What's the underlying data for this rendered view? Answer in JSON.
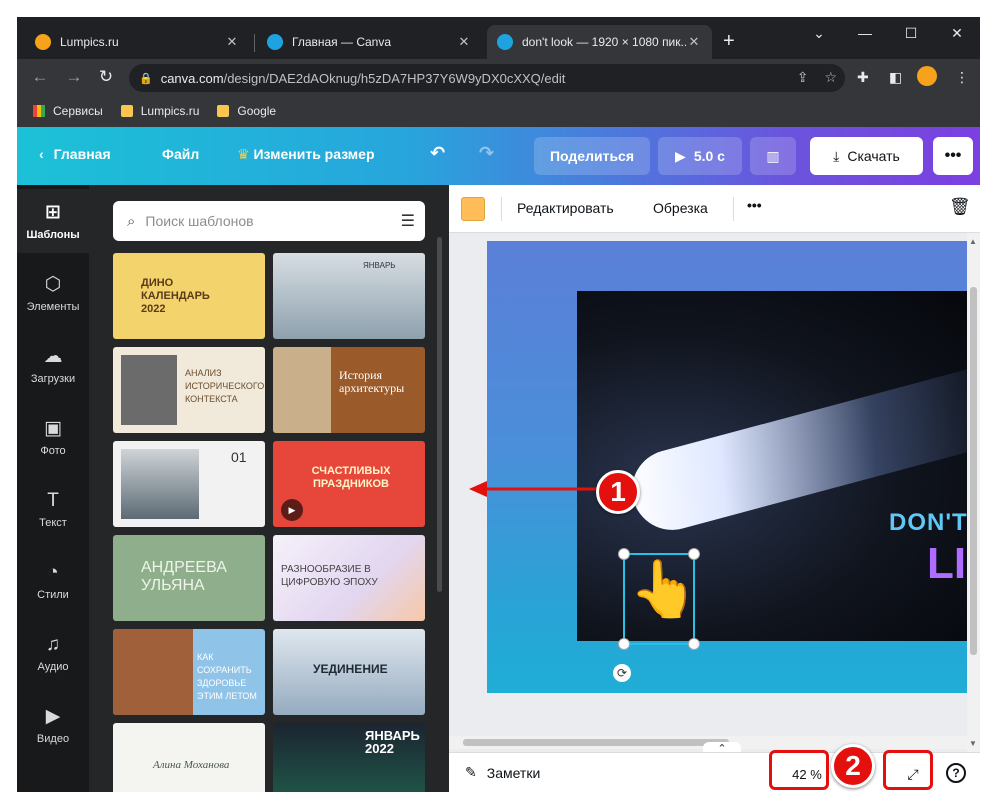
{
  "browser": {
    "tabs": [
      {
        "title": "Lumpics.ru",
        "color": "#f7a21b"
      },
      {
        "title": "Главная — Canva",
        "color": "#1fa3e0"
      },
      {
        "title": "don't look — 1920 × 1080 пик...",
        "color": "#1fa3e0"
      }
    ],
    "url_domain": "canva.com",
    "url_path": "/design/DAE2dAOknug/h5zDA7HP37Y6W9yDX0cXXQ/edit",
    "bookmarks": [
      "Сервисы",
      "Lumpics.ru",
      "Google"
    ]
  },
  "header": {
    "home": "Главная",
    "file": "Файл",
    "resize": "Изменить размер",
    "share": "Поделиться",
    "duration": "5.0 с",
    "download": "Скачать"
  },
  "sidebar": {
    "items": [
      {
        "label": "Шаблоны",
        "icon": "templates-icon"
      },
      {
        "label": "Элементы",
        "icon": "elements-icon"
      },
      {
        "label": "Загрузки",
        "icon": "upload-icon"
      },
      {
        "label": "Фото",
        "icon": "photo-icon"
      },
      {
        "label": "Текст",
        "icon": "text-icon"
      },
      {
        "label": "Стили",
        "icon": "styles-icon"
      },
      {
        "label": "Аудио",
        "icon": "audio-icon"
      },
      {
        "label": "Видео",
        "icon": "video-icon"
      }
    ]
  },
  "panel": {
    "search_placeholder": "Поиск шаблонов",
    "templates": [
      {
        "text": "ДИНО КАЛЕНДАРЬ 2022",
        "bg": "#f3d36b"
      },
      {
        "text": "ЯНВАРЬ",
        "bg": "#cfd8dc"
      },
      {
        "text": "АНАЛИЗ ИСТОРИЧЕСКОГО КОНТЕКСТА",
        "bg": "#f1eadb"
      },
      {
        "text": "История архитектуры",
        "bg": "#9a5a2a"
      },
      {
        "text": "01",
        "bg": "#4b4c4e"
      },
      {
        "text": "СЧАСТЛИВЫХ ПРАЗДНИКОВ",
        "bg": "#e7473a"
      },
      {
        "text": "АНДРЕЕВА УЛЬЯНА",
        "bg": "#8fae8b"
      },
      {
        "text": "РАЗНООБРАЗИЕ В ЦИФРОВУЮ ЭПОХУ",
        "bg": "#e9e3f2"
      },
      {
        "text": "КАК СОХРАНИТЬ ЗДОРОВЬЕ ЭТИМ ЛЕТОМ",
        "bg": "#8fc3e8"
      },
      {
        "text": "УЕДИНЕНИЕ",
        "bg": "#b3c5d6"
      },
      {
        "text": "Алина Моханова",
        "bg": "#f4f4f0"
      },
      {
        "text": "ЯНВАРЬ 2022",
        "bg": "#1c2430"
      }
    ]
  },
  "context_toolbar": {
    "swatch_color": "#ffbd59",
    "edit": "Редактировать",
    "crop": "Обрезка"
  },
  "canvas": {
    "text_line1": "DON'T",
    "text_line2": "LI"
  },
  "footer": {
    "notes": "Заметки",
    "zoom": "42 %"
  },
  "annotations": {
    "badge1": "1",
    "badge2": "2",
    "accent": "#e3100e"
  }
}
